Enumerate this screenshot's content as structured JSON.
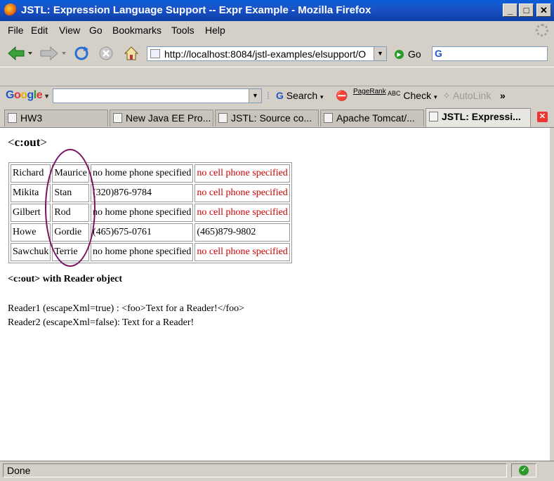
{
  "window": {
    "title": "JSTL: Expression Language Support -- Expr Example - Mozilla Firefox",
    "minimize_glyph": "_",
    "maximize_glyph": "□",
    "close_glyph": "✕"
  },
  "menu": {
    "items": [
      "File",
      "Edit",
      "View",
      "Go",
      "Bookmarks",
      "Tools",
      "Help"
    ]
  },
  "nav": {
    "url": "http://localhost:8084/jstl-examples/elsupport/O",
    "go_label": "Go"
  },
  "googlebar": {
    "logo": "Google",
    "search_label": "Search",
    "pagerank_label": "PageRank",
    "check_label": "Check",
    "autolink_label": "AutoLink",
    "overflow": "»"
  },
  "tabs": [
    {
      "label": "HW3",
      "active": false
    },
    {
      "label": "New Java EE Pro...",
      "active": false
    },
    {
      "label": "JSTL: Source co...",
      "active": false
    },
    {
      "label": "Apache Tomcat/...",
      "active": false
    },
    {
      "label": "JSTL: Expressi...",
      "active": true
    }
  ],
  "page": {
    "heading": "<c:out>",
    "heading_open": "<",
    "heading_tag": "c:out",
    "heading_close": ">",
    "table": [
      {
        "last": "Richard",
        "first": "Maurice",
        "home": "no home phone specified",
        "cell": "no cell phone specified",
        "home_missing": true,
        "cell_missing": true
      },
      {
        "last": "Mikita",
        "first": "Stan",
        "home": "(320)876-9784",
        "cell": "no cell phone specified",
        "home_missing": false,
        "cell_missing": true
      },
      {
        "last": "Gilbert",
        "first": "Rod",
        "home": "no home phone specified",
        "cell": "no cell phone specified",
        "home_missing": true,
        "cell_missing": true
      },
      {
        "last": "Howe",
        "first": "Gordie",
        "home": "(465)675-0761",
        "cell": "(465)879-9802",
        "home_missing": false,
        "cell_missing": false
      },
      {
        "last": "Sawchuk",
        "first": "Terrie",
        "home": "no home phone specified",
        "cell": "no cell phone specified",
        "home_missing": true,
        "cell_missing": true
      }
    ],
    "reader_heading": "<c:out> with Reader object",
    "reader1": "Reader1 (escapeXml=true) : <foo>Text for a Reader!</foo>",
    "reader2": "Reader2 (escapeXml=false): Text for a Reader!",
    "missing_color": "#cc0000",
    "annotation_color": "#7a1060"
  },
  "status": {
    "text": "Done"
  }
}
